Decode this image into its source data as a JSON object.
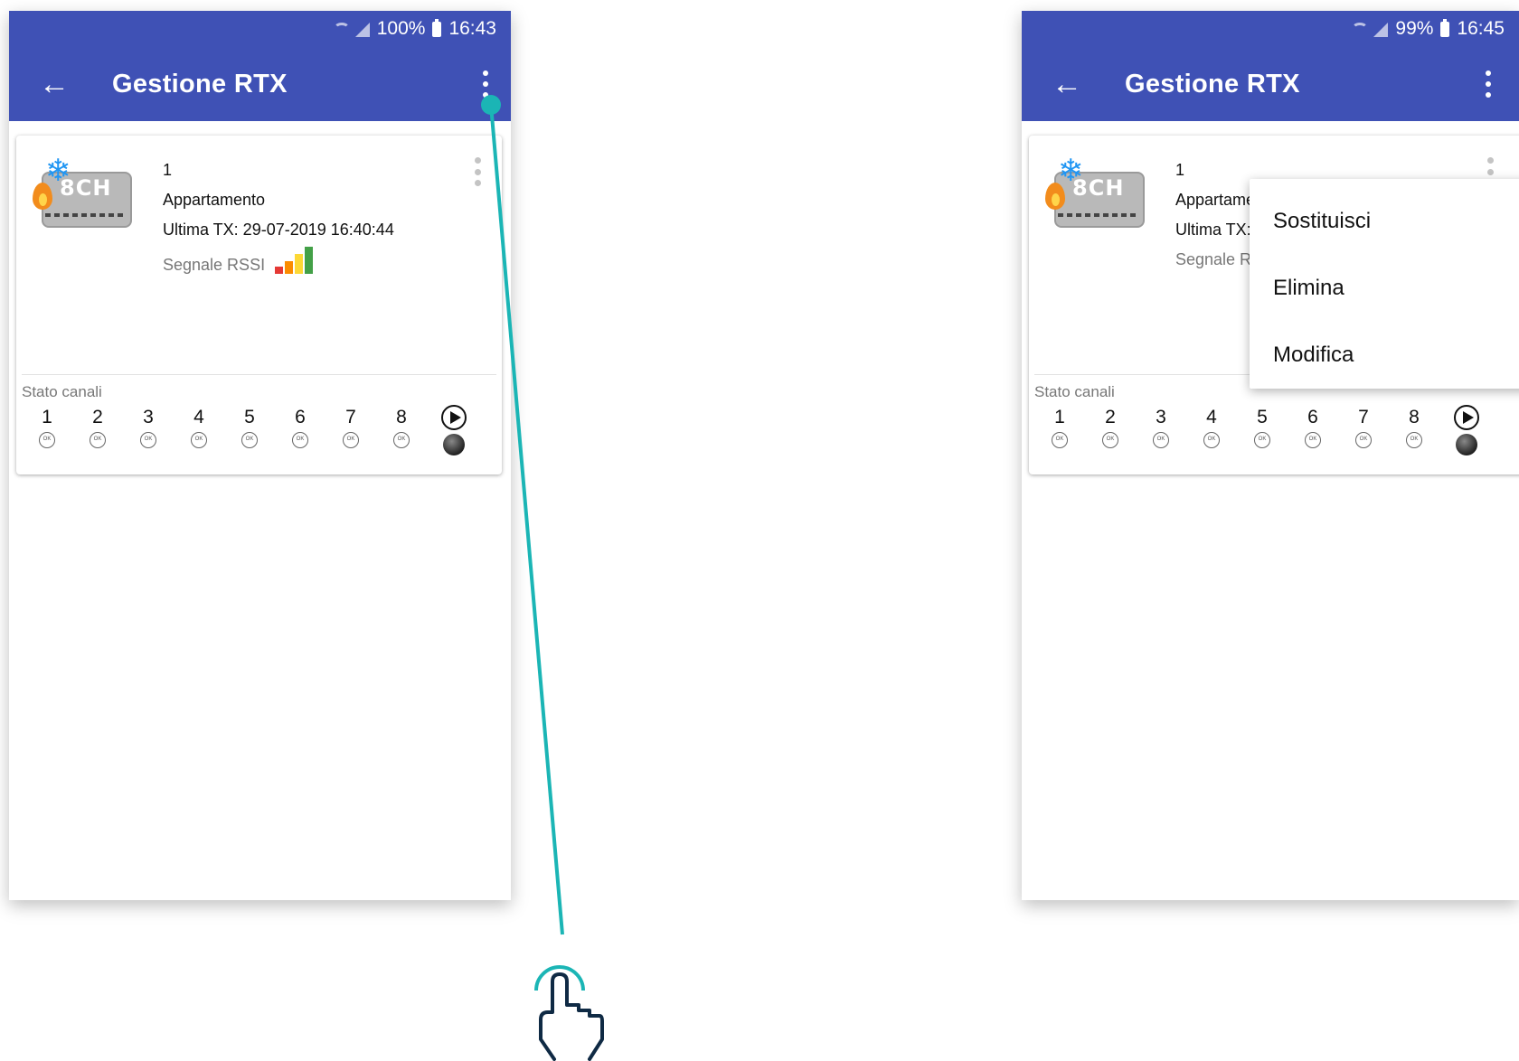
{
  "colors": {
    "app_bar": "#3f51b5",
    "accent_line": "#1bb5b5",
    "hand_outline": "#0f2a44"
  },
  "screens": [
    {
      "status": {
        "battery": "100%",
        "time": "16:43"
      },
      "title": "Gestione RTX",
      "card": {
        "device_badge": "8CH",
        "id": "1",
        "name": "Appartamento",
        "last_tx": "Ultima TX: 29-07-2019 16:40:44",
        "rssi_label": "Segnale RSSI",
        "rssi_level": 4,
        "rssi_max": 4,
        "channels_label": "Stato canali",
        "channels": [
          "1",
          "2",
          "3",
          "4",
          "5",
          "6",
          "7",
          "8"
        ],
        "channel_state": "OK"
      }
    },
    {
      "status": {
        "battery": "99%",
        "time": "16:45"
      },
      "title": "Gestione RTX",
      "card": {
        "device_badge": "8CH",
        "id": "1",
        "name": "Appartame",
        "last_tx": "Ultima TX:",
        "rssi_label": "Segnale RS",
        "channels_label": "Stato canali",
        "channels": [
          "1",
          "2",
          "3",
          "4",
          "5",
          "6",
          "7",
          "8"
        ],
        "channel_state": "OK"
      },
      "menu": [
        "Sostituisci",
        "Elimina",
        "Modifica"
      ]
    }
  ],
  "icons": [
    "wifi-signal-icon",
    "battery-icon",
    "back-arrow-icon",
    "overflow-menu-icon",
    "flame-icon",
    "snowflake-icon",
    "play-icon",
    "ball-indicator-icon",
    "tap-hand-icon"
  ]
}
